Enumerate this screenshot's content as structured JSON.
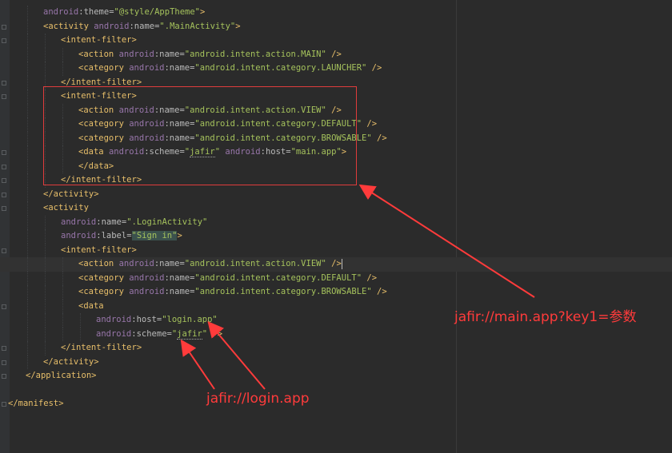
{
  "editor": {
    "lines": [
      {
        "indent": 2,
        "tokens": [
          [
            "ns",
            "android"
          ],
          [
            "attr",
            ":theme="
          ],
          [
            "val",
            "\"@style/AppTheme\""
          ],
          [
            "tag",
            ">"
          ]
        ]
      },
      {
        "indent": 2,
        "tokens": [
          [
            "tag",
            "<activity "
          ],
          [
            "ns",
            "android"
          ],
          [
            "attr",
            ":name="
          ],
          [
            "val",
            "\".MainActivity\""
          ],
          [
            "tag",
            ">"
          ]
        ]
      },
      {
        "indent": 3,
        "tokens": [
          [
            "tag",
            "<intent-filter>"
          ]
        ]
      },
      {
        "indent": 4,
        "tokens": [
          [
            "tag",
            "<action "
          ],
          [
            "ns",
            "android"
          ],
          [
            "attr",
            ":name="
          ],
          [
            "val",
            "\"android.intent.action.MAIN\""
          ],
          [
            "tag",
            " />"
          ]
        ]
      },
      {
        "indent": 4,
        "tokens": [
          [
            "tag",
            "<category "
          ],
          [
            "ns",
            "android"
          ],
          [
            "attr",
            ":name="
          ],
          [
            "val",
            "\"android.intent.category.LAUNCHER\""
          ],
          [
            "tag",
            " />"
          ]
        ]
      },
      {
        "indent": 3,
        "tokens": [
          [
            "tag",
            "</intent-filter>"
          ]
        ]
      },
      {
        "indent": 3,
        "tokens": [
          [
            "tag",
            "<intent-filter>"
          ]
        ]
      },
      {
        "indent": 4,
        "tokens": [
          [
            "tag",
            "<action "
          ],
          [
            "ns",
            "android"
          ],
          [
            "attr",
            ":name="
          ],
          [
            "val",
            "\"android.intent.action.VIEW\""
          ],
          [
            "tag",
            " />"
          ]
        ]
      },
      {
        "indent": 4,
        "tokens": [
          [
            "tag",
            "<category "
          ],
          [
            "ns",
            "android"
          ],
          [
            "attr",
            ":name="
          ],
          [
            "val",
            "\"android.intent.category.DEFAULT\""
          ],
          [
            "tag",
            " />"
          ]
        ]
      },
      {
        "indent": 4,
        "tokens": [
          [
            "tag",
            "<category "
          ],
          [
            "ns",
            "android"
          ],
          [
            "attr",
            ":name="
          ],
          [
            "val",
            "\"android.intent.category.BROWSABLE\""
          ],
          [
            "tag",
            " />"
          ]
        ]
      },
      {
        "indent": 4,
        "tokens": [
          [
            "tag",
            "<data "
          ],
          [
            "ns",
            "android"
          ],
          [
            "attr",
            ":scheme="
          ],
          [
            "val",
            "\""
          ],
          [
            "val squig",
            "jafir"
          ],
          [
            "val",
            "\""
          ],
          [
            "tag",
            " "
          ],
          [
            "ns",
            "android"
          ],
          [
            "attr",
            ":host="
          ],
          [
            "val",
            "\"main.app\""
          ],
          [
            "tag",
            ">"
          ]
        ]
      },
      {
        "indent": 4,
        "tokens": [
          [
            "tag",
            "</data>"
          ]
        ]
      },
      {
        "indent": 3,
        "tokens": [
          [
            "tag",
            "</intent-filter>"
          ]
        ]
      },
      {
        "indent": 2,
        "tokens": [
          [
            "tag",
            "</activity>"
          ]
        ]
      },
      {
        "indent": 2,
        "tokens": [
          [
            "tag",
            "<activity"
          ]
        ]
      },
      {
        "indent": 3,
        "tokens": [
          [
            "ns",
            "android"
          ],
          [
            "attr",
            ":name="
          ],
          [
            "val",
            "\".LoginActivity\""
          ]
        ]
      },
      {
        "indent": 3,
        "tokens": [
          [
            "ns",
            "android"
          ],
          [
            "attr",
            ":label="
          ],
          [
            "val hl",
            "\"Sign in\""
          ],
          [
            "tag",
            ">"
          ]
        ]
      },
      {
        "indent": 3,
        "tokens": [
          [
            "tag",
            "<intent-filter>"
          ]
        ]
      },
      {
        "indent": 4,
        "caret": true,
        "tokens": [
          [
            "tag",
            "<action "
          ],
          [
            "ns",
            "android"
          ],
          [
            "attr",
            ":name="
          ],
          [
            "val",
            "\"android.intent.action.VIEW\""
          ],
          [
            "tag",
            " />"
          ]
        ]
      },
      {
        "indent": 4,
        "tokens": [
          [
            "tag",
            "<category "
          ],
          [
            "ns",
            "android"
          ],
          [
            "attr",
            ":name="
          ],
          [
            "val",
            "\"android.intent.category.DEFAULT\""
          ],
          [
            "tag",
            " />"
          ]
        ]
      },
      {
        "indent": 4,
        "tokens": [
          [
            "tag",
            "<category "
          ],
          [
            "ns",
            "android"
          ],
          [
            "attr",
            ":name="
          ],
          [
            "val",
            "\"android.intent.category.BROWSABLE\""
          ],
          [
            "tag",
            " />"
          ]
        ]
      },
      {
        "indent": 4,
        "tokens": [
          [
            "tag",
            "<data"
          ]
        ]
      },
      {
        "indent": 5,
        "tokens": [
          [
            "ns",
            "android"
          ],
          [
            "attr",
            ":host="
          ],
          [
            "val",
            "\"login.app\""
          ]
        ]
      },
      {
        "indent": 5,
        "tokens": [
          [
            "ns",
            "android"
          ],
          [
            "attr",
            ":scheme="
          ],
          [
            "val",
            "\""
          ],
          [
            "val squig",
            "jafir"
          ],
          [
            "val",
            "\""
          ],
          [
            "tag",
            " />"
          ]
        ]
      },
      {
        "indent": 3,
        "tokens": [
          [
            "tag",
            "</intent-filter>"
          ]
        ]
      },
      {
        "indent": 2,
        "tokens": [
          [
            "tag",
            "</activity>"
          ]
        ]
      },
      {
        "indent": 1,
        "tokens": [
          [
            "tag",
            "</application>"
          ]
        ]
      },
      {
        "indent": 0,
        "tokens": []
      },
      {
        "indent": 0,
        "tokens": [
          [
            "tag",
            "</manifest>"
          ]
        ]
      }
    ],
    "colors": {
      "background": "#2b2b2b",
      "tag": "#e8bf6a",
      "namespace": "#9876aa",
      "value": "#a5c25c",
      "annotation": "#ff3b3b"
    }
  },
  "annotations": {
    "main_url": "jafir://main.app?key1=参数",
    "login_url": "jafir://login.app"
  }
}
